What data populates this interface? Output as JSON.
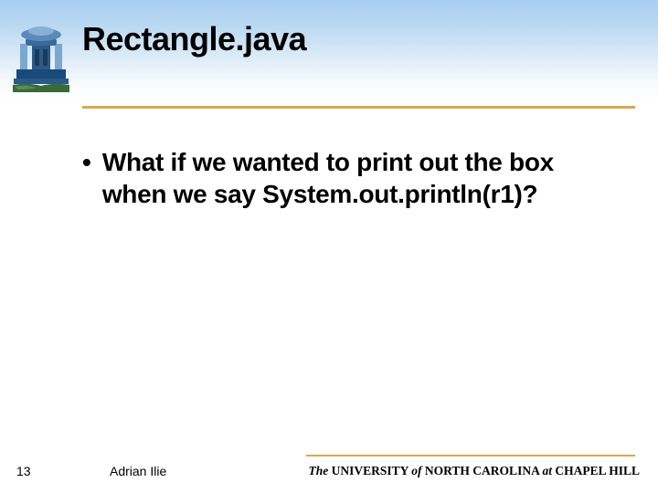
{
  "slide": {
    "title": "Rectangle.java",
    "bullet_text": "What if we wanted to print out the box when we say System.out.println(r1)?"
  },
  "footer": {
    "page_number": "13",
    "author": "Adrian Ilie",
    "university_the": "The",
    "university_name": " UNIVERSITY ",
    "university_of": "of",
    "university_rest": " NORTH CAROLINA ",
    "university_at": "at",
    "university_place": " CHAPEL HILL"
  },
  "colors": {
    "accent": "#d9a94a",
    "header_blue": "#a8cef0"
  }
}
